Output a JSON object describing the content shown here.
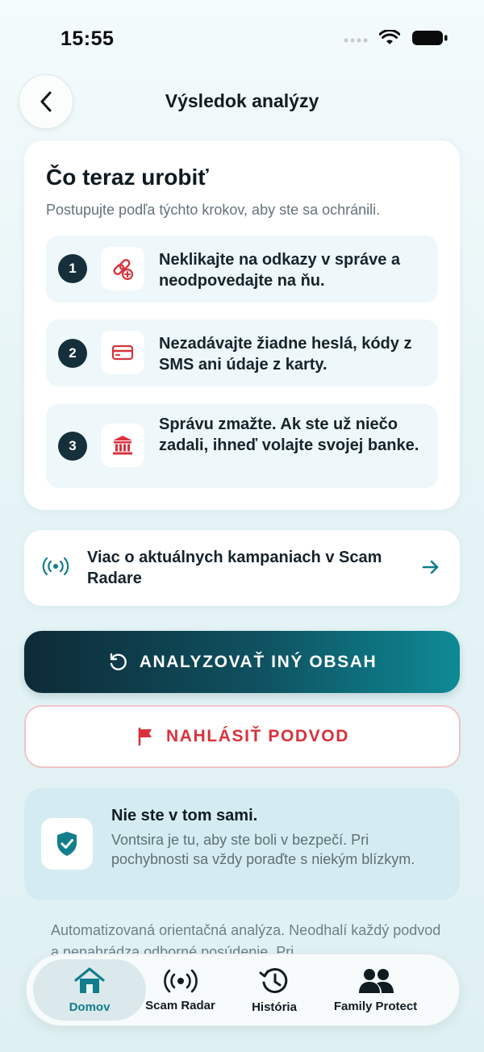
{
  "status_bar": {
    "time": "15:55"
  },
  "header": {
    "title": "Výsledok analýzy"
  },
  "steps": {
    "title": "Čo teraz urobiť",
    "subtitle": "Postupujte podľa týchto krokov, aby ste sa ochránili.",
    "items": [
      {
        "number": "1",
        "icon": "link-plus-icon",
        "text": "Neklikajte na odkazy v správe a neodpovedajte na ňu."
      },
      {
        "number": "2",
        "icon": "credit-card-icon",
        "text": "Nezadávajte žiadne heslá, kódy z SMS ani údaje z karty."
      },
      {
        "number": "3",
        "icon": "bank-icon",
        "text": "Správu zmažte. Ak ste už niečo zadali, ihneď volajte svojej banke."
      }
    ]
  },
  "radar_link": {
    "text": "Viac o aktuálnych kampaniach v Scam Radare",
    "icon": "radar-signal-icon"
  },
  "buttons": {
    "analyze": "ANALYZOVAŤ INÝ OBSAH",
    "report": "NAHLÁSIŤ PODVOD"
  },
  "info": {
    "title": "Nie ste v tom sami.",
    "text": "Vontsira je tu, aby ste boli v bezpečí. Pri pochybnosti sa vždy poraďte s niekým blízkym."
  },
  "disclaimer": "Automatizovaná orientačná analýza. Neodhalí každý podvod a nenahrádza odborné posúdenie. Pri",
  "tabs": [
    {
      "label": "Domov",
      "icon": "home-icon",
      "active": true
    },
    {
      "label": "Scam Radar",
      "icon": "radar-signal-icon",
      "active": false
    },
    {
      "label": "História",
      "icon": "history-icon",
      "active": false
    },
    {
      "label": "Family Protect",
      "icon": "family-icon",
      "active": false
    }
  ],
  "colors": {
    "accent": "#127e8c",
    "danger": "#d9323c",
    "dark": "#15303a"
  }
}
